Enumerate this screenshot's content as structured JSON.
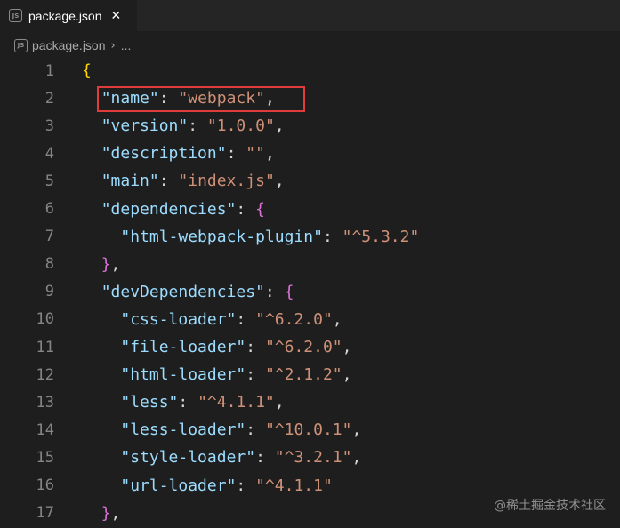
{
  "tab": {
    "icon_text": "JS",
    "title": "package.json",
    "close_symbol": "✕"
  },
  "breadcrumb": {
    "icon_text": "JS",
    "file": "package.json",
    "separator": "›",
    "more": "..."
  },
  "lines": [
    {
      "num": "1",
      "indent": "",
      "tokens": [
        {
          "t": "{",
          "c": "brace"
        }
      ]
    },
    {
      "num": "2",
      "indent": "  ",
      "tokens": [
        {
          "t": "\"name\"",
          "c": "key"
        },
        {
          "t": ": ",
          "c": "punc"
        },
        {
          "t": "\"webpack\"",
          "c": "str"
        },
        {
          "t": ",",
          "c": "punc"
        }
      ]
    },
    {
      "num": "3",
      "indent": "  ",
      "tokens": [
        {
          "t": "\"version\"",
          "c": "key"
        },
        {
          "t": ": ",
          "c": "punc"
        },
        {
          "t": "\"1.0.0\"",
          "c": "str"
        },
        {
          "t": ",",
          "c": "punc"
        }
      ]
    },
    {
      "num": "4",
      "indent": "  ",
      "tokens": [
        {
          "t": "\"description\"",
          "c": "key"
        },
        {
          "t": ": ",
          "c": "punc"
        },
        {
          "t": "\"\"",
          "c": "str"
        },
        {
          "t": ",",
          "c": "punc"
        }
      ]
    },
    {
      "num": "5",
      "indent": "  ",
      "tokens": [
        {
          "t": "\"main\"",
          "c": "key"
        },
        {
          "t": ": ",
          "c": "punc"
        },
        {
          "t": "\"index.js\"",
          "c": "str"
        },
        {
          "t": ",",
          "c": "punc"
        }
      ]
    },
    {
      "num": "6",
      "indent": "  ",
      "tokens": [
        {
          "t": "\"dependencies\"",
          "c": "key"
        },
        {
          "t": ": ",
          "c": "punc"
        },
        {
          "t": "{",
          "c": "bracket"
        }
      ]
    },
    {
      "num": "7",
      "indent": "    ",
      "tokens": [
        {
          "t": "\"html-webpack-plugin\"",
          "c": "key"
        },
        {
          "t": ": ",
          "c": "punc"
        },
        {
          "t": "\"^5.3.2\"",
          "c": "str"
        }
      ]
    },
    {
      "num": "8",
      "indent": "  ",
      "tokens": [
        {
          "t": "}",
          "c": "bracket"
        },
        {
          "t": ",",
          "c": "punc"
        }
      ]
    },
    {
      "num": "9",
      "indent": "  ",
      "tokens": [
        {
          "t": "\"devDependencies\"",
          "c": "key"
        },
        {
          "t": ": ",
          "c": "punc"
        },
        {
          "t": "{",
          "c": "bracket"
        }
      ]
    },
    {
      "num": "10",
      "indent": "    ",
      "tokens": [
        {
          "t": "\"css-loader\"",
          "c": "key"
        },
        {
          "t": ": ",
          "c": "punc"
        },
        {
          "t": "\"^6.2.0\"",
          "c": "str"
        },
        {
          "t": ",",
          "c": "punc"
        }
      ]
    },
    {
      "num": "11",
      "indent": "    ",
      "tokens": [
        {
          "t": "\"file-loader\"",
          "c": "key"
        },
        {
          "t": ": ",
          "c": "punc"
        },
        {
          "t": "\"^6.2.0\"",
          "c": "str"
        },
        {
          "t": ",",
          "c": "punc"
        }
      ]
    },
    {
      "num": "12",
      "indent": "    ",
      "tokens": [
        {
          "t": "\"html-loader\"",
          "c": "key"
        },
        {
          "t": ": ",
          "c": "punc"
        },
        {
          "t": "\"^2.1.2\"",
          "c": "str"
        },
        {
          "t": ",",
          "c": "punc"
        }
      ]
    },
    {
      "num": "13",
      "indent": "    ",
      "tokens": [
        {
          "t": "\"less\"",
          "c": "key"
        },
        {
          "t": ": ",
          "c": "punc"
        },
        {
          "t": "\"^4.1.1\"",
          "c": "str"
        },
        {
          "t": ",",
          "c": "punc"
        }
      ]
    },
    {
      "num": "14",
      "indent": "    ",
      "tokens": [
        {
          "t": "\"less-loader\"",
          "c": "key"
        },
        {
          "t": ": ",
          "c": "punc"
        },
        {
          "t": "\"^10.0.1\"",
          "c": "str"
        },
        {
          "t": ",",
          "c": "punc"
        }
      ]
    },
    {
      "num": "15",
      "indent": "    ",
      "tokens": [
        {
          "t": "\"style-loader\"",
          "c": "key"
        },
        {
          "t": ": ",
          "c": "punc"
        },
        {
          "t": "\"^3.2.1\"",
          "c": "str"
        },
        {
          "t": ",",
          "c": "punc"
        }
      ]
    },
    {
      "num": "16",
      "indent": "    ",
      "tokens": [
        {
          "t": "\"url-loader\"",
          "c": "key"
        },
        {
          "t": ": ",
          "c": "punc"
        },
        {
          "t": "\"^4.1.1\"",
          "c": "str"
        }
      ]
    },
    {
      "num": "17",
      "indent": "  ",
      "tokens": [
        {
          "t": "}",
          "c": "bracket"
        },
        {
          "t": ",",
          "c": "punc"
        }
      ]
    }
  ],
  "watermark": "@稀土掘金技术社区",
  "colors": {
    "background": "#1e1e1e",
    "key": "#9cdcfe",
    "string": "#ce9178",
    "brace": "#ffd700",
    "bracket": "#da70d6",
    "line_number": "#858585",
    "highlight_border": "#e03c3c"
  }
}
